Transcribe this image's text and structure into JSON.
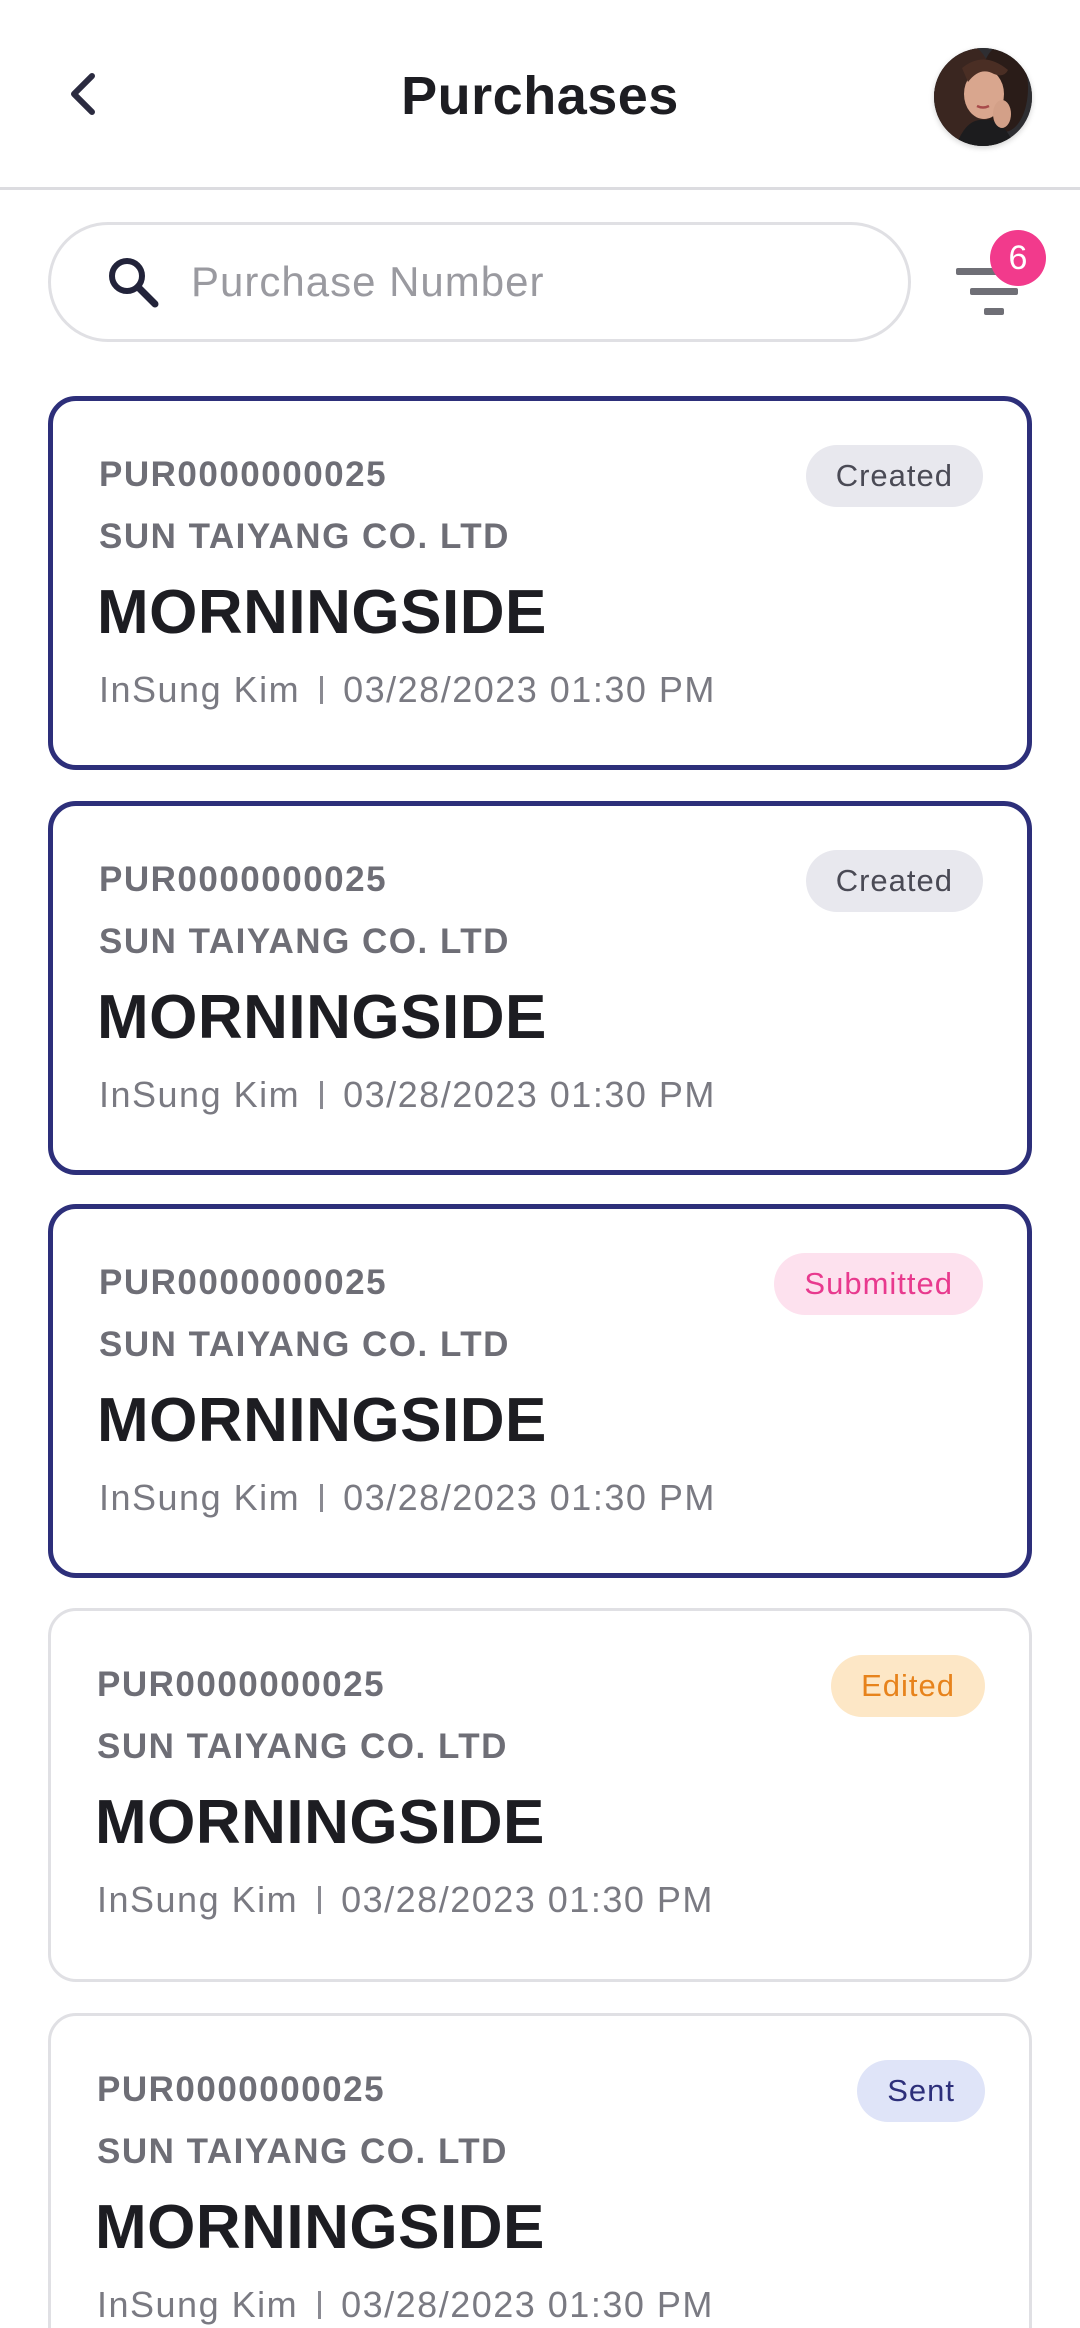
{
  "header": {
    "title": "Purchases",
    "back_icon": "chevron-left-icon",
    "avatar_alt": "user-avatar"
  },
  "search": {
    "placeholder": "Purchase Number",
    "value": "",
    "icon": "search-icon"
  },
  "filter": {
    "icon": "filter-icon",
    "badge_count": "6"
  },
  "colors": {
    "primary": "#2d2f7a",
    "accent_pink": "#f23a8c",
    "text_dark": "#1d1d22",
    "text_muted": "#6e6e76"
  },
  "purchases": [
    {
      "number": "PUR0000000025",
      "supplier": "SUN TAIYANG CO. LTD",
      "customer": "MORNINGSIDE",
      "user": "InSung Kim",
      "datetime": "03/28/2023 01:30 PM",
      "status": "Created",
      "selected": true
    },
    {
      "number": "PUR0000000025",
      "supplier": "SUN TAIYANG CO. LTD",
      "customer": "MORNINGSIDE",
      "user": "InSung Kim",
      "datetime": "03/28/2023 01:30 PM",
      "status": "Created",
      "selected": true
    },
    {
      "number": "PUR0000000025",
      "supplier": "SUN TAIYANG CO. LTD",
      "customer": "MORNINGSIDE",
      "user": "InSung Kim",
      "datetime": "03/28/2023 01:30 PM",
      "status": "Submitted",
      "selected": true
    },
    {
      "number": "PUR0000000025",
      "supplier": "SUN TAIYANG CO. LTD",
      "customer": "MORNINGSIDE",
      "user": "InSung Kim",
      "datetime": "03/28/2023 01:30 PM",
      "status": "Edited",
      "selected": false
    },
    {
      "number": "PUR0000000025",
      "supplier": "SUN TAIYANG CO. LTD",
      "customer": "MORNINGSIDE",
      "user": "InSung Kim",
      "datetime": "03/28/2023 01:30 PM",
      "status": "Sent",
      "selected": false
    }
  ]
}
